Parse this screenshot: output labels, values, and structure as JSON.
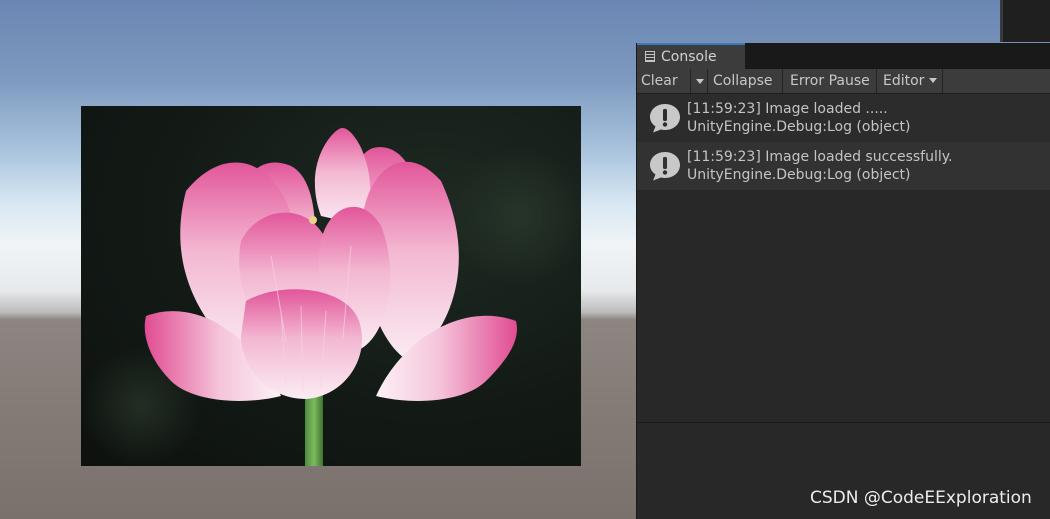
{
  "console": {
    "tab_label": "Console",
    "toolbar": {
      "clear_label": "Clear",
      "collapse_label": "Collapse",
      "error_pause_label": "Error Pause",
      "editor_label": "Editor"
    },
    "entries": [
      {
        "line1": "[11:59:23] Image loaded .....",
        "line2": "UnityEngine.Debug:Log (object)",
        "icon": "info-icon"
      },
      {
        "line1": "[11:59:23] Image loaded successfully.",
        "line2": "UnityEngine.Debug:Log (object)",
        "icon": "info-icon"
      }
    ]
  },
  "watermark": "CSDN @CodeEExploration",
  "colors": {
    "panel_bg": "#282828",
    "toolbar_bg": "#3c3c3c",
    "tab_accent": "#3a79bb",
    "petal_pink": "#e0609a"
  }
}
